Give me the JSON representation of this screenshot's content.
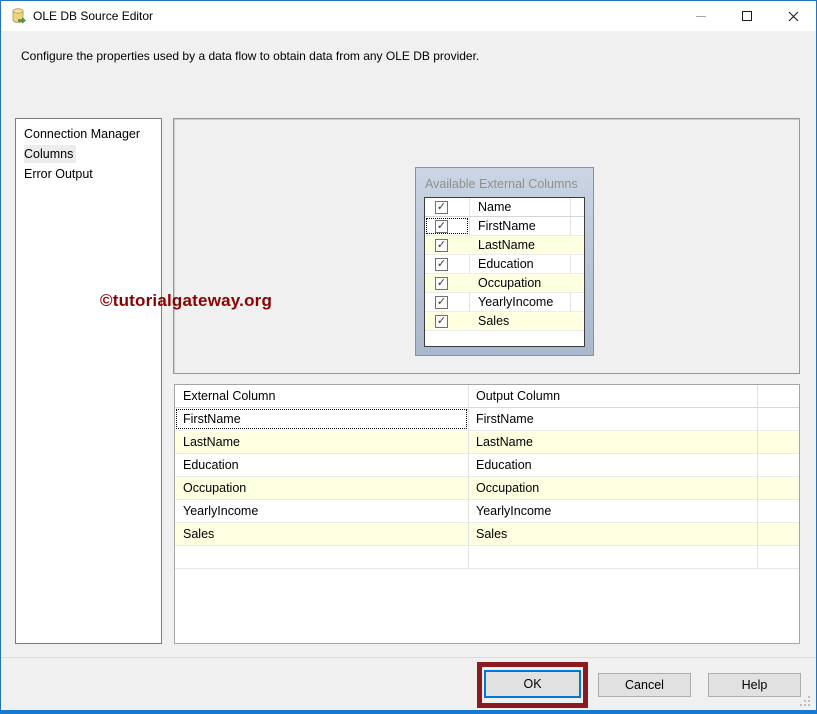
{
  "window": {
    "title": "OLE DB Source Editor",
    "description": "Configure the properties used by a data flow to obtain data from any OLE DB provider."
  },
  "nav": {
    "selected": "Columns",
    "items": [
      {
        "label": "Connection Manager"
      },
      {
        "label": "Columns"
      },
      {
        "label": "Error Output"
      }
    ]
  },
  "available_columns": {
    "title": "Available External Columns",
    "name_header": "Name",
    "select_all_checked": true,
    "items": [
      {
        "label": "FirstName",
        "checked": true
      },
      {
        "label": "LastName",
        "checked": true
      },
      {
        "label": "Education",
        "checked": true
      },
      {
        "label": "Occupation",
        "checked": true
      },
      {
        "label": "YearlyIncome",
        "checked": true
      },
      {
        "label": "Sales",
        "checked": true
      }
    ]
  },
  "mapping_table": {
    "headers": {
      "external": "External Column",
      "output": "Output Column"
    },
    "rows": [
      {
        "external": "FirstName",
        "output": "FirstName"
      },
      {
        "external": "LastName",
        "output": "LastName"
      },
      {
        "external": "Education",
        "output": "Education"
      },
      {
        "external": "Occupation",
        "output": "Occupation"
      },
      {
        "external": "YearlyIncome",
        "output": "YearlyIncome"
      },
      {
        "external": "Sales",
        "output": "Sales"
      }
    ]
  },
  "watermark": "©tutorialgateway.org",
  "buttons": {
    "ok": "OK",
    "cancel": "Cancel",
    "help": "Help"
  },
  "colors": {
    "annotation_border": "#8B1A22",
    "ok_focus_border": "#0078D7",
    "row_alternate": "#FFFFE1",
    "watermark_text": "#8B0000",
    "window_frame": "#1779D0"
  }
}
